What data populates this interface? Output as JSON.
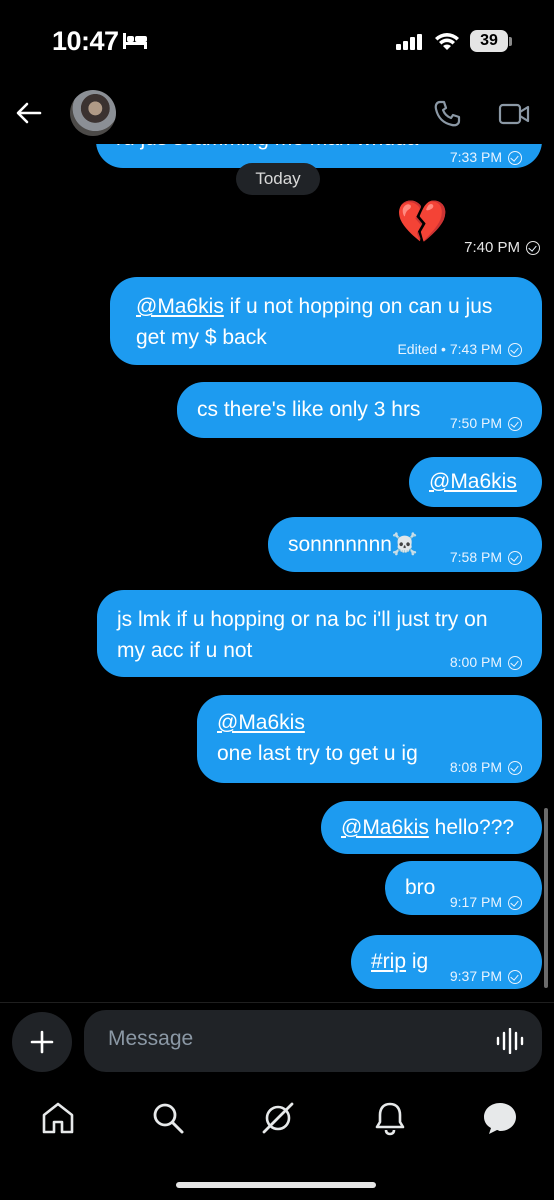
{
  "status_bar": {
    "time": "10:47",
    "battery": "39"
  },
  "header": {
    "avatar": "contact-avatar"
  },
  "conversation": {
    "cut_off_text": "ru jus scamming me man whdda",
    "cut_off_time": "7:33 PM",
    "date_divider": "Today",
    "emoji": "💔",
    "emoji_time": "7:40 PM",
    "messages": [
      {
        "mention": "@Ma6kis",
        "text1": " if u not hopping on can u jus",
        "text2": "get my $ back",
        "edited": "Edited",
        "time": "7:43 PM"
      },
      {
        "text": "cs there's like only 3 hrs",
        "time": "7:50 PM"
      },
      {
        "mention": "@Ma6kis"
      },
      {
        "text": "sonnnnnnn☠️",
        "time": "7:58 PM"
      },
      {
        "text1": "js lmk if u hopping or na bc i'll just try on",
        "text2": "my acc if u not",
        "time": "8:00 PM"
      },
      {
        "mention": "@Ma6kis",
        "text2": "one last try to get u ig",
        "time": "8:08 PM"
      },
      {
        "mention": "@Ma6kis",
        "text": " hello???"
      },
      {
        "text": "bro",
        "time": "9:17 PM"
      },
      {
        "hashtag": "#rip",
        "text": " ig",
        "time": "9:37 PM"
      }
    ]
  },
  "composer": {
    "placeholder": "Message"
  },
  "tab_bar": [
    "home-icon",
    "search-icon",
    "grok-icon",
    "notifications-icon",
    "messages-icon"
  ],
  "colors": {
    "bubble": "#1d9bf0",
    "background": "#000000",
    "input": "#202327"
  }
}
